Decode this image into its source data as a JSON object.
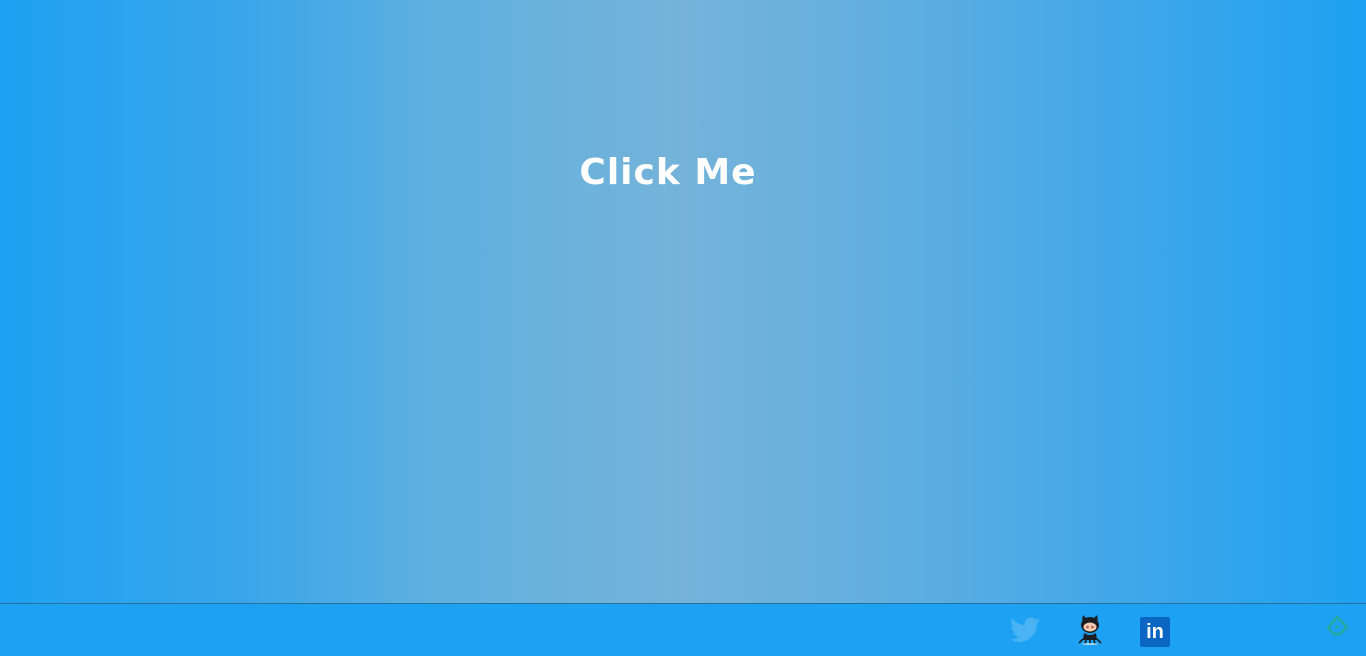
{
  "main": {
    "button_label": "Click Me"
  },
  "footer": {
    "social_links": [
      {
        "name": "twitter",
        "icon": "twitter-icon"
      },
      {
        "name": "github",
        "icon": "github-octocat-icon"
      },
      {
        "name": "linkedin",
        "icon": "linkedin-icon",
        "label": "in"
      }
    ],
    "corner_icon": "feedly-icon"
  },
  "colors": {
    "primary_blue": "#1da1f2",
    "center_blue": "#75b3d9",
    "linkedin_blue": "#0a66c2",
    "text": "#ffffff"
  }
}
